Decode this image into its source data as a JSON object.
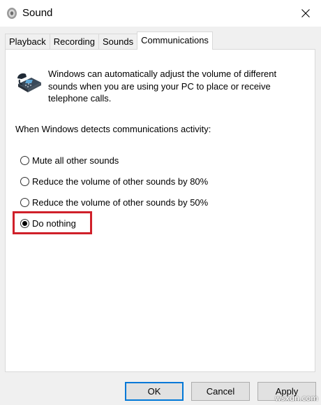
{
  "window": {
    "title": "Sound",
    "title_icon": "speaker-icon",
    "close_icon": "close-icon"
  },
  "tabs": [
    {
      "label": "Playback",
      "active": false
    },
    {
      "label": "Recording",
      "active": false
    },
    {
      "label": "Sounds",
      "active": false
    },
    {
      "label": "Communications",
      "active": true
    }
  ],
  "communications": {
    "icon": "telephone-icon",
    "description": "Windows can automatically adjust the volume of different sounds when you are using your PC to place or receive telephone calls.",
    "detect_label": "When Windows detects communications activity:",
    "options": [
      {
        "label": "Mute all other sounds",
        "selected": false
      },
      {
        "label": "Reduce the volume of other sounds by 80%",
        "selected": false
      },
      {
        "label": "Reduce the volume of other sounds by 50%",
        "selected": false
      },
      {
        "label": "Do nothing",
        "selected": true
      }
    ],
    "highlight_color": "#d0202a"
  },
  "buttons": {
    "ok": "OK",
    "cancel": "Cancel",
    "apply": "Apply"
  },
  "watermark": "wsxdn.com"
}
